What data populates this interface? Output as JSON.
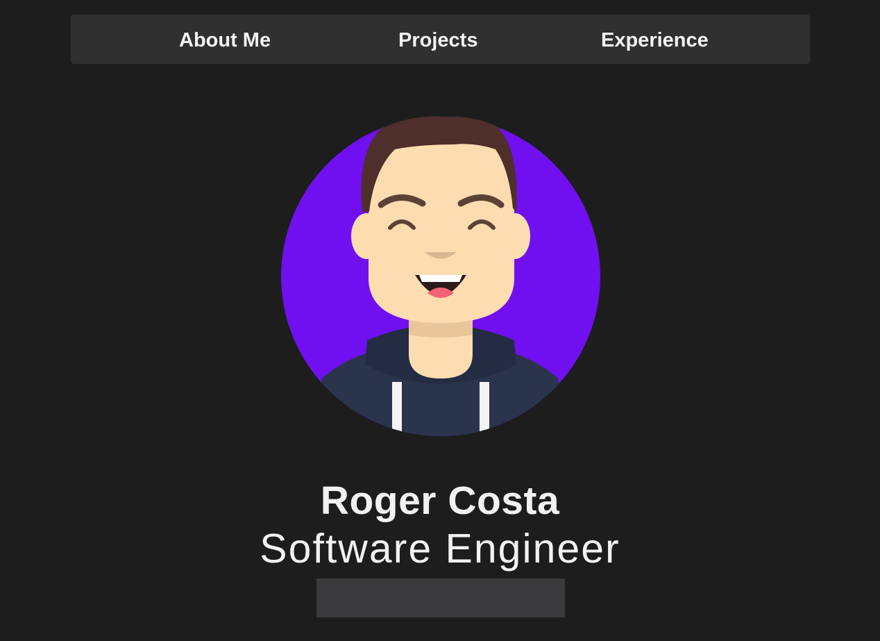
{
  "nav": {
    "items": [
      {
        "label": "About Me"
      },
      {
        "label": "Projects"
      },
      {
        "label": "Experience"
      }
    ]
  },
  "profile": {
    "name": "Roger Costa",
    "title": "Software Engineer",
    "avatar_icon": "avatar-illustration"
  },
  "colors": {
    "background": "#1d1d1d",
    "nav_background": "#303030",
    "accent_purple": "#7010f0",
    "hoodie": "#2a344c",
    "skin": "#fddcb0",
    "hair": "#4e2f2b",
    "button_background": "#3a393b"
  }
}
